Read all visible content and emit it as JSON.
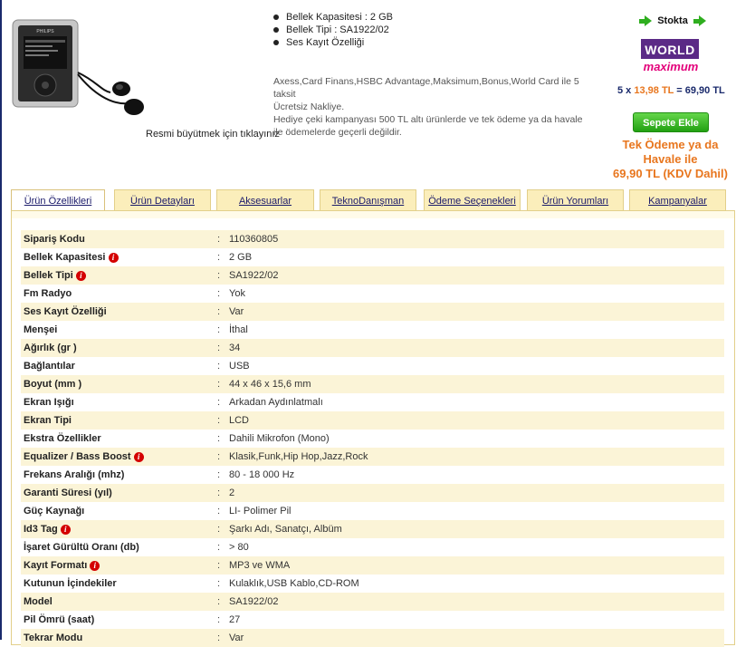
{
  "product": {
    "image_caption": "Resmi büyütmek için tıklayınız",
    "features": [
      "Bellek Kapasitesi : 2 GB",
      "Bellek Tipi : SA1922/02",
      "Ses Kayıt Özelliği"
    ],
    "promo_lines": [
      "Axess,Card Finans,HSBC Advantage,Maksimum,Bonus,World Card ile 5 taksit",
      "Ücretsiz Nakliye.",
      "Hediye çeki kampanyası 500 TL altı ürünlerde ve tek ödeme ya da havale ile ödemelerde geçerli değildir."
    ],
    "device_brand": "PHILIPS"
  },
  "purchase": {
    "stock_label": "Stokta",
    "card_world_label": "WORLD",
    "card_max_label": "maximum",
    "installment_count": "5 x",
    "installment_amount": "13,98 TL",
    "installment_total": "= 69,90 TL",
    "cart_button": "Sepete Ekle",
    "single_payment_text": "Tek Ödeme ya da Havale ile",
    "single_payment_price": "69,90 TL (KDV Dahil)"
  },
  "tabs": [
    {
      "label": "Ürün Özellikleri",
      "active": true
    },
    {
      "label": "Ürün Detayları",
      "active": false
    },
    {
      "label": "Aksesuarlar",
      "active": false
    },
    {
      "label": "TeknoDanışman",
      "active": false
    },
    {
      "label": "Ödeme Seçenekleri",
      "active": false
    },
    {
      "label": "Ürün Yorumları",
      "active": false
    },
    {
      "label": "Kampanyalar",
      "active": false
    }
  ],
  "specs": [
    {
      "label": "Sipariş Kodu",
      "value": "110360805",
      "info": false
    },
    {
      "label": "Bellek Kapasitesi",
      "value": "2 GB",
      "info": true
    },
    {
      "label": "Bellek Tipi",
      "value": "SA1922/02",
      "info": true
    },
    {
      "label": "Fm Radyo",
      "value": "Yok",
      "info": false
    },
    {
      "label": "Ses Kayıt Özelliği",
      "value": "Var",
      "info": false
    },
    {
      "label": "Menşei",
      "value": "İthal",
      "info": false
    },
    {
      "label": "Ağırlık (gr )",
      "value": "34",
      "info": false
    },
    {
      "label": "Bağlantılar",
      "value": "USB",
      "info": false
    },
    {
      "label": "Boyut (mm )",
      "value": "44 x 46 x 15,6 mm",
      "info": false
    },
    {
      "label": "Ekran Işığı",
      "value": "Arkadan Aydınlatmalı",
      "info": false
    },
    {
      "label": "Ekran Tipi",
      "value": "LCD",
      "info": false
    },
    {
      "label": "Ekstra Özellikler",
      "value": "Dahili Mikrofon (Mono)",
      "info": false
    },
    {
      "label": "Equalizer / Bass Boost",
      "value": "Klasik,Funk,Hip Hop,Jazz,Rock",
      "info": true
    },
    {
      "label": "Frekans Aralığı (mhz)",
      "value": "80 - 18 000 Hz",
      "info": false
    },
    {
      "label": "Garanti Süresi (yıl)",
      "value": "2",
      "info": false
    },
    {
      "label": "Güç Kaynağı",
      "value": "LI- Polimer Pil",
      "info": false
    },
    {
      "label": "Id3 Tag",
      "value": "Şarkı Adı, Sanatçı, Albüm",
      "info": true
    },
    {
      "label": "İşaret Gürültü Oranı (db)",
      "value": "> 80",
      "info": false
    },
    {
      "label": "Kayıt Formatı",
      "value": "MP3 ve WMA",
      "info": true
    },
    {
      "label": "Kutunun İçindekiler",
      "value": "Kulaklık,USB Kablo,CD-ROM",
      "info": false
    },
    {
      "label": "Model",
      "value": "SA1922/02",
      "info": false
    },
    {
      "label": "Pil Ömrü (saat)",
      "value": "27",
      "info": false
    },
    {
      "label": "Tekrar Modu",
      "value": "Var",
      "info": false
    }
  ],
  "spec_colon": ":",
  "info_glyph": "i"
}
